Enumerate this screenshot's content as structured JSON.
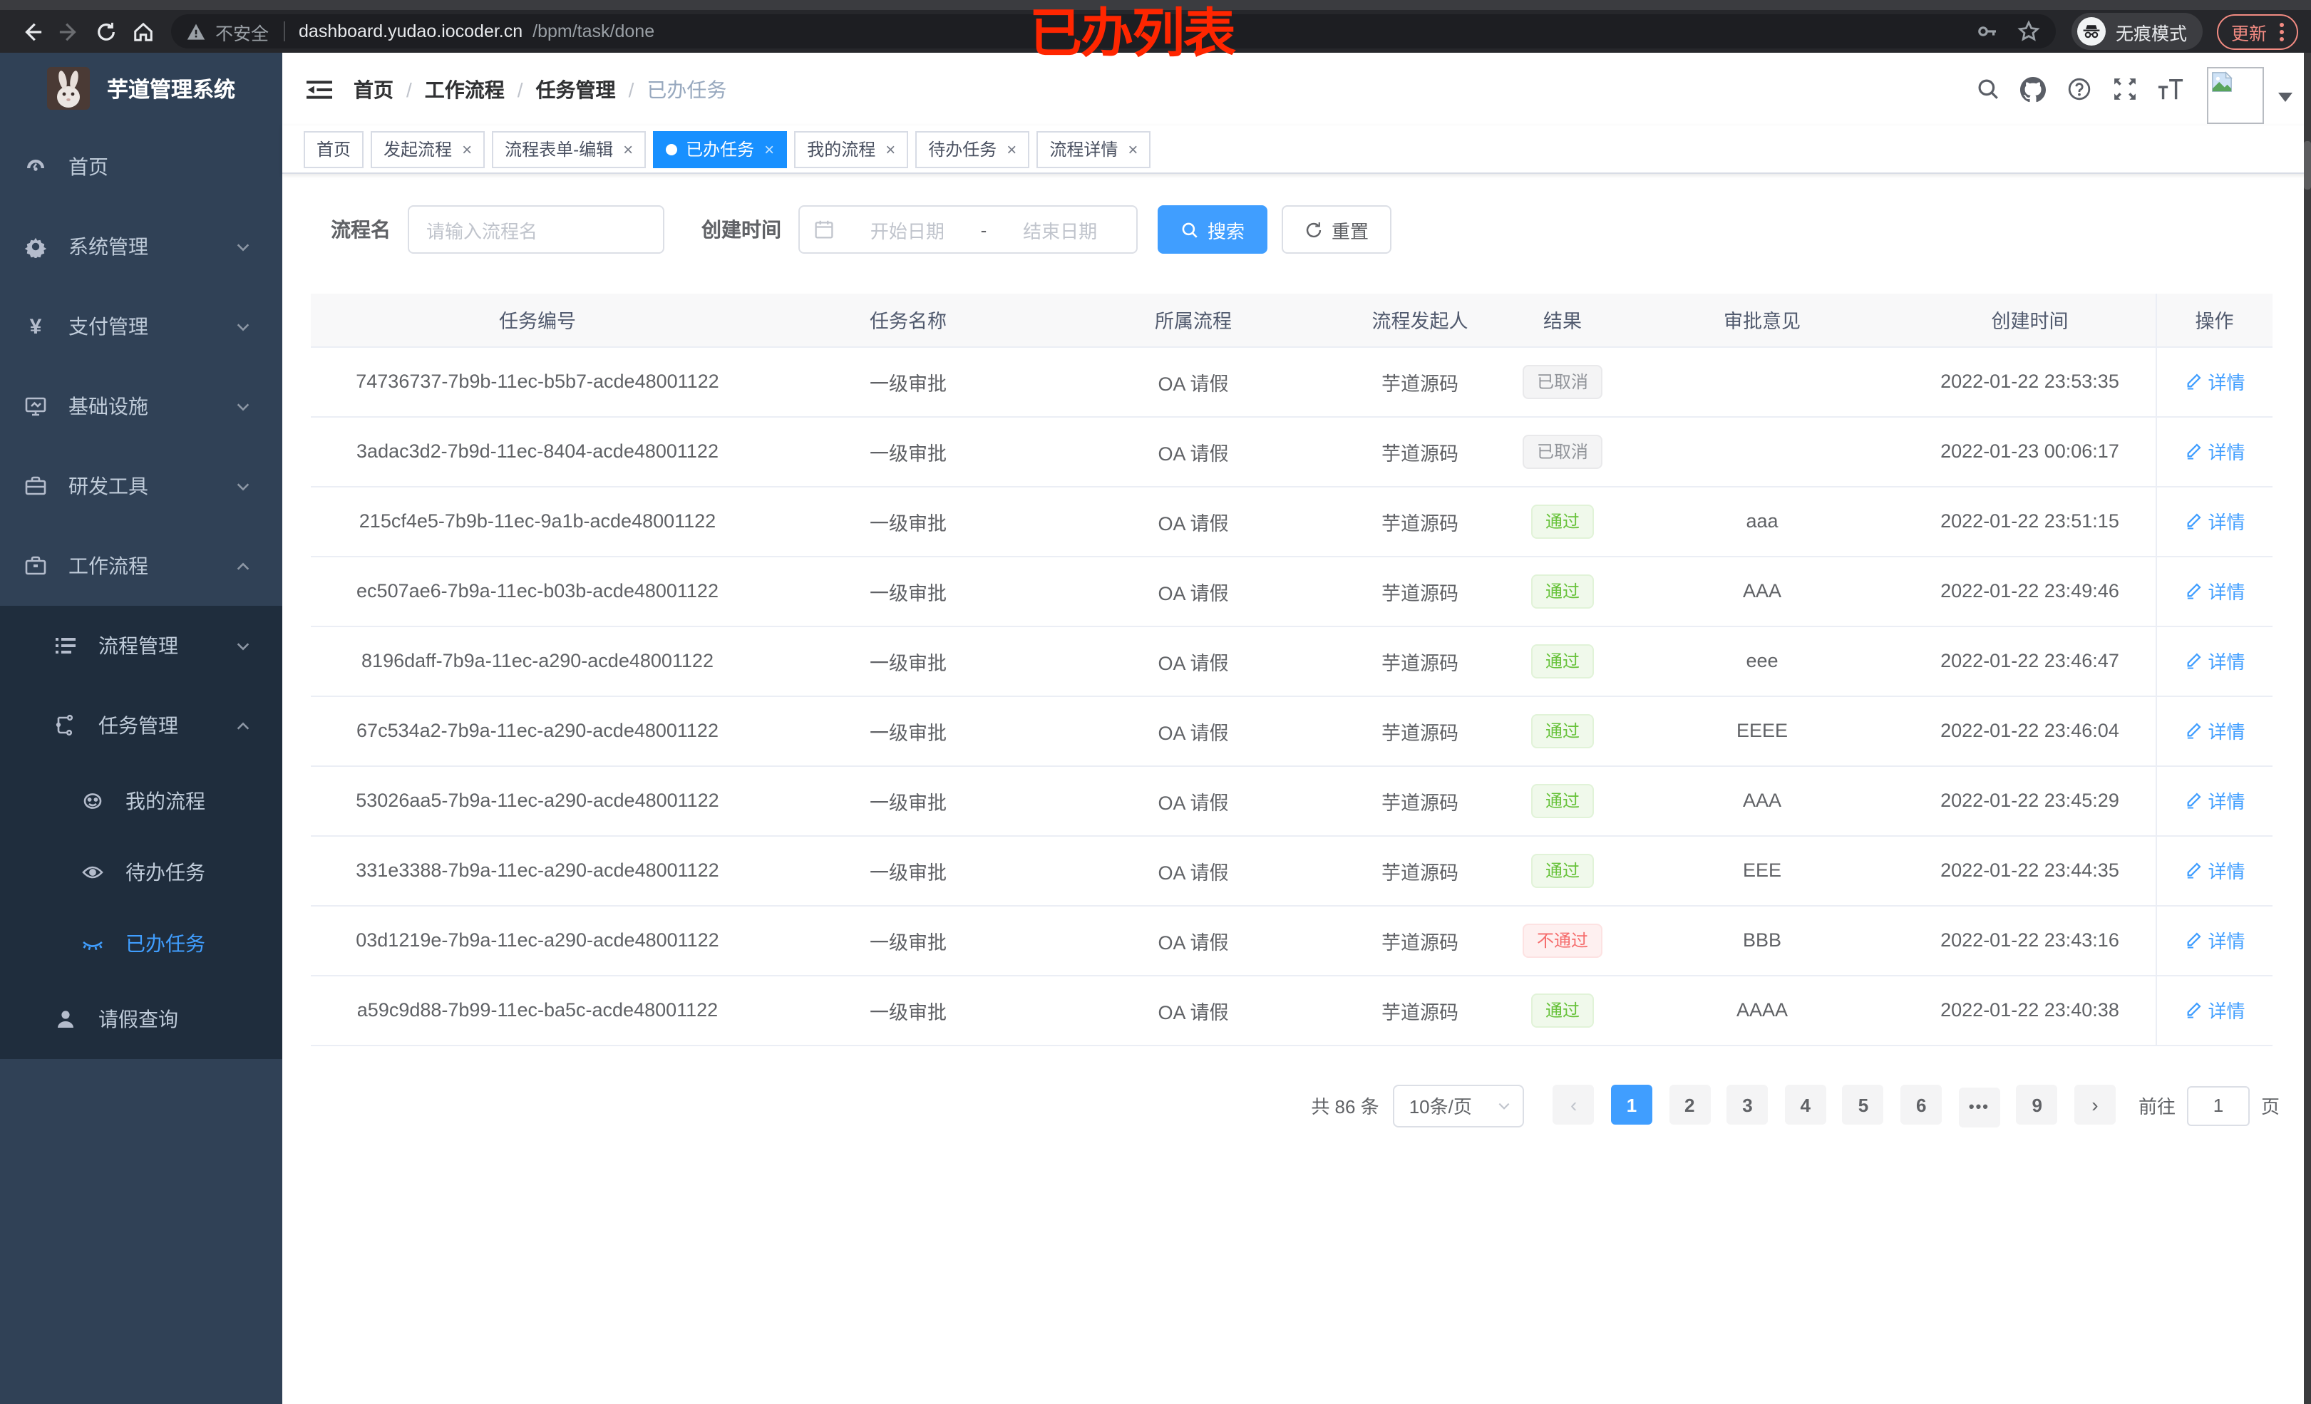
{
  "colors": {
    "accent_blue": "#409eff",
    "active_tab_blue": "#1890ff",
    "sidebar_bg": "#304156",
    "submenu_bg": "#1f2d3d",
    "success_green": "#67c23a",
    "danger_red": "#f56c6c",
    "info_gray": "#909399",
    "annotation_red": "#ff2600",
    "chrome_update_red": "#f28b82"
  },
  "browser": {
    "nav_icons": [
      "back-arrow",
      "forward-arrow",
      "reload",
      "home"
    ],
    "security_label": "不安全",
    "url_host": "dashboard.yudao.iocoder.cn",
    "url_path": "/bpm/task/done",
    "omnibox_icons": [
      "warning-triangle",
      "key",
      "star"
    ],
    "incognito_label": "无痕模式",
    "update_label": "更新"
  },
  "annotation": {
    "text": "已办列表"
  },
  "sidebar": {
    "title": "芋道管理系统",
    "items": [
      {
        "label": "首页",
        "icon": "dashboard-icon"
      },
      {
        "label": "系统管理",
        "icon": "gear-icon",
        "chevron": "down"
      },
      {
        "label": "支付管理",
        "icon": "yen-icon",
        "chevron": "down"
      },
      {
        "label": "基础设施",
        "icon": "monitor-icon",
        "chevron": "down"
      },
      {
        "label": "研发工具",
        "icon": "toolbox-icon",
        "chevron": "down"
      },
      {
        "label": "工作流程",
        "icon": "briefcase-icon",
        "chevron": "up"
      },
      {
        "label": "流程管理",
        "icon": "list-tree-icon",
        "chevron": "down"
      },
      {
        "label": "任务管理",
        "icon": "flow-icon",
        "chevron": "up"
      },
      {
        "label": "我的流程",
        "icon": "face-icon"
      },
      {
        "label": "待办任务",
        "icon": "eye-open-icon"
      },
      {
        "label": "已办任务",
        "icon": "eye-close-icon",
        "active": true
      },
      {
        "label": "请假查询",
        "icon": "user-icon"
      }
    ]
  },
  "breadcrumb": [
    "首页",
    "工作流程",
    "任务管理",
    "已办任务"
  ],
  "header_icons": [
    "search",
    "github",
    "help",
    "fullscreen",
    "font-size",
    "avatar",
    "caret-down"
  ],
  "tags_view": [
    {
      "label": "首页",
      "active": false,
      "closable": false
    },
    {
      "label": "发起流程",
      "active": false,
      "closable": true
    },
    {
      "label": "流程表单-编辑",
      "active": false,
      "closable": true
    },
    {
      "label": "已办任务",
      "active": true,
      "closable": true
    },
    {
      "label": "我的流程",
      "active": false,
      "closable": true
    },
    {
      "label": "待办任务",
      "active": false,
      "closable": true
    },
    {
      "label": "流程详情",
      "active": false,
      "closable": true
    }
  ],
  "filters": {
    "name_label": "流程名",
    "name_placeholder": "请输入流程名",
    "date_label": "创建时间",
    "date_start_placeholder": "开始日期",
    "date_separator": "-",
    "date_end_placeholder": "结束日期",
    "search_label": "搜索",
    "reset_label": "重置"
  },
  "table": {
    "columns": [
      "任务编号",
      "任务名称",
      "所属流程",
      "流程发起人",
      "结果",
      "审批意见",
      "创建时间",
      "操作"
    ],
    "rows": [
      {
        "id": "74736737-7b9b-11ec-b5b7-acde48001122",
        "name": "一级审批",
        "process": "OA 请假",
        "initiator": "芋道源码",
        "result_label": "已取消",
        "result_status": "cancel",
        "comment": "",
        "created": "2022-01-22 23:53:35",
        "action": "详情"
      },
      {
        "id": "3adac3d2-7b9d-11ec-8404-acde48001122",
        "name": "一级审批",
        "process": "OA 请假",
        "initiator": "芋道源码",
        "result_label": "已取消",
        "result_status": "cancel",
        "comment": "",
        "created": "2022-01-23 00:06:17",
        "action": "详情"
      },
      {
        "id": "215cf4e5-7b9b-11ec-9a1b-acde48001122",
        "name": "一级审批",
        "process": "OA 请假",
        "initiator": "芋道源码",
        "result_label": "通过",
        "result_status": "pass",
        "comment": "aaa",
        "created": "2022-01-22 23:51:15",
        "action": "详情"
      },
      {
        "id": "ec507ae6-7b9a-11ec-b03b-acde48001122",
        "name": "一级审批",
        "process": "OA 请假",
        "initiator": "芋道源码",
        "result_label": "通过",
        "result_status": "pass",
        "comment": "AAA",
        "created": "2022-01-22 23:49:46",
        "action": "详情"
      },
      {
        "id": "8196daff-7b9a-11ec-a290-acde48001122",
        "name": "一级审批",
        "process": "OA 请假",
        "initiator": "芋道源码",
        "result_label": "通过",
        "result_status": "pass",
        "comment": "eee",
        "created": "2022-01-22 23:46:47",
        "action": "详情"
      },
      {
        "id": "67c534a2-7b9a-11ec-a290-acde48001122",
        "name": "一级审批",
        "process": "OA 请假",
        "initiator": "芋道源码",
        "result_label": "通过",
        "result_status": "pass",
        "comment": "EEEE",
        "created": "2022-01-22 23:46:04",
        "action": "详情"
      },
      {
        "id": "53026aa5-7b9a-11ec-a290-acde48001122",
        "name": "一级审批",
        "process": "OA 请假",
        "initiator": "芋道源码",
        "result_label": "通过",
        "result_status": "pass",
        "comment": "AAA",
        "created": "2022-01-22 23:45:29",
        "action": "详情"
      },
      {
        "id": "331e3388-7b9a-11ec-a290-acde48001122",
        "name": "一级审批",
        "process": "OA 请假",
        "initiator": "芋道源码",
        "result_label": "通过",
        "result_status": "pass",
        "comment": "EEE",
        "created": "2022-01-22 23:44:35",
        "action": "详情"
      },
      {
        "id": "03d1219e-7b9a-11ec-a290-acde48001122",
        "name": "一级审批",
        "process": "OA 请假",
        "initiator": "芋道源码",
        "result_label": "不通过",
        "result_status": "reject",
        "comment": "BBB",
        "created": "2022-01-22 23:43:16",
        "action": "详情"
      },
      {
        "id": "a59c9d88-7b99-11ec-ba5c-acde48001122",
        "name": "一级审批",
        "process": "OA 请假",
        "initiator": "芋道源码",
        "result_label": "通过",
        "result_status": "pass",
        "comment": "AAAA",
        "created": "2022-01-22 23:40:38",
        "action": "详情"
      }
    ]
  },
  "pagination": {
    "total_label": "共 86 条",
    "page_size_label": "10条/页",
    "pages": [
      {
        "type": "prev",
        "label": "‹",
        "disabled": true
      },
      {
        "type": "page",
        "label": "1",
        "active": true
      },
      {
        "type": "page",
        "label": "2"
      },
      {
        "type": "page",
        "label": "3"
      },
      {
        "type": "page",
        "label": "4"
      },
      {
        "type": "page",
        "label": "5"
      },
      {
        "type": "page",
        "label": "6"
      },
      {
        "type": "ellipsis",
        "label": "•••"
      },
      {
        "type": "page",
        "label": "9"
      },
      {
        "type": "next",
        "label": "›"
      }
    ],
    "goto_label": "前往",
    "goto_value": "1",
    "goto_suffix": "页"
  }
}
